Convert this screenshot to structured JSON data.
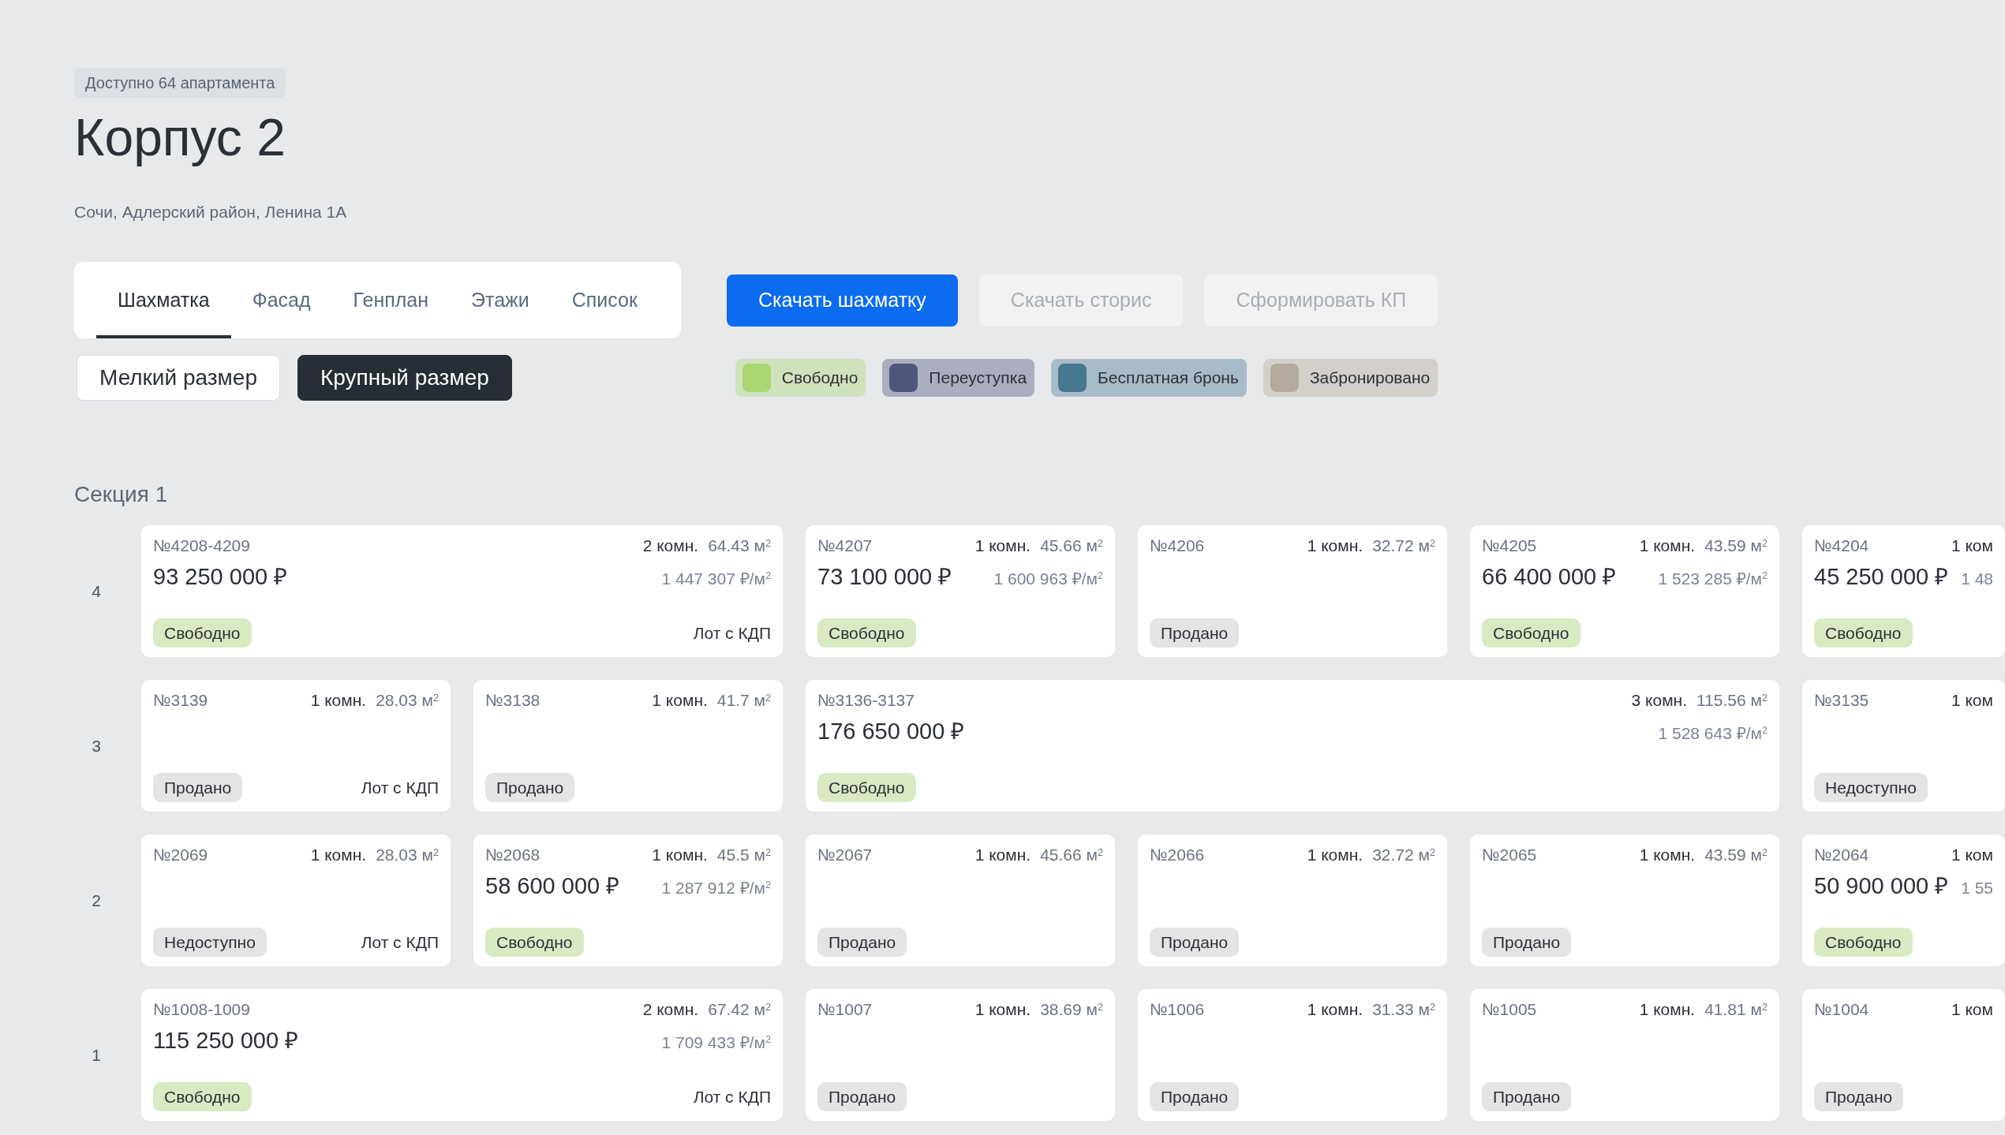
{
  "availability_badge": "Доступно 64 апартамента",
  "title": "Корпус 2",
  "address": "Сочи, Адлерский район, Ленина 1А",
  "tabs": [
    {
      "label": "Шахматка",
      "selected": true
    },
    {
      "label": "Фасад",
      "selected": false
    },
    {
      "label": "Генплан",
      "selected": false
    },
    {
      "label": "Этажи",
      "selected": false
    },
    {
      "label": "Список",
      "selected": false
    }
  ],
  "actions": [
    {
      "label": "Скачать шахматку",
      "disabled": false
    },
    {
      "label": "Скачать сторис",
      "disabled": true
    },
    {
      "label": "Сформировать КП",
      "disabled": true
    }
  ],
  "size_toggle": [
    {
      "label": "Мелкий размер",
      "selected": false
    },
    {
      "label": "Крупный размер",
      "selected": true
    }
  ],
  "legend": [
    {
      "label": "Свободно",
      "color": "#a9d673"
    },
    {
      "label": "Переуступка",
      "color": "#50557a"
    },
    {
      "label": "Бесплатная бронь",
      "color": "#46788f"
    },
    {
      "label": "Забронировано",
      "color": "#b4aa9c"
    }
  ],
  "section_title": "Секция 1",
  "floors": [
    {
      "label": "4",
      "units": [
        {
          "kind": "double",
          "number": "№4208-4209",
          "rooms": "2 комн.",
          "area": "64.43 м$^{2}$",
          "price": "93 250 000 ₽",
          "price_per_m2": "1 447 307 ₽/м$^{2}$",
          "status": {
            "kind": "free",
            "label": "Свободно"
          },
          "note": "Лот с КДП"
        },
        {
          "kind": "single",
          "number": "№4207",
          "rooms": "1 комн.",
          "area": "45.66 м$^{2}$",
          "price": "73 100 000 ₽",
          "price_per_m2": "1 600 963 ₽/м$^{2}$",
          "status": {
            "kind": "free",
            "label": "Свободно"
          }
        },
        {
          "kind": "single",
          "number": "№4206",
          "rooms": "1 комн.",
          "area": "32.72 м$^{2}$",
          "status": {
            "kind": "sold",
            "label": "Продано"
          }
        },
        {
          "kind": "single",
          "number": "№4205",
          "rooms": "1 комн.",
          "area": "43.59 м$^{2}$",
          "price": "66 400 000 ₽",
          "price_per_m2": "1 523 285 ₽/м$^{2}$",
          "status": {
            "kind": "free",
            "label": "Свободно"
          }
        },
        {
          "kind": "single",
          "number": "№4204",
          "rooms": "1 ком",
          "price": "45 250 000 ₽",
          "price_per_m2": "1 48",
          "status": {
            "kind": "free",
            "label": "Свободно"
          }
        }
      ]
    },
    {
      "label": "3",
      "units": [
        {
          "kind": "single",
          "number": "№3139",
          "rooms": "1 комн.",
          "area": "28.03 м$^{2}$",
          "status": {
            "kind": "sold",
            "label": "Продано"
          },
          "note": "Лот с КДП"
        },
        {
          "kind": "single",
          "number": "№3138",
          "rooms": "1 комн.",
          "area": "41.7 м$^{2}$",
          "status": {
            "kind": "sold",
            "label": "Продано"
          }
        },
        {
          "kind": "triple",
          "number": "№3136-3137",
          "rooms": "3 комн.",
          "area": "115.56 м$^{2}$",
          "price": "176 650 000 ₽",
          "price_per_m2": "1 528 643 ₽/м$^{2}$",
          "status": {
            "kind": "free",
            "label": "Свободно"
          }
        },
        {
          "kind": "single",
          "number": "№3135",
          "rooms": "1 ком",
          "status": {
            "kind": "unavailable",
            "label": "Недоступно"
          }
        }
      ]
    },
    {
      "label": "2",
      "units": [
        {
          "kind": "single",
          "number": "№2069",
          "rooms": "1 комн.",
          "area": "28.03 м$^{2}$",
          "status": {
            "kind": "unavailable",
            "label": "Недоступно"
          },
          "note": "Лот с КДП"
        },
        {
          "kind": "single",
          "number": "№2068",
          "rooms": "1 комн.",
          "area": "45.5 м$^{2}$",
          "price": "58 600 000 ₽",
          "price_per_m2": "1 287 912 ₽/м$^{2}$",
          "status": {
            "kind": "free",
            "label": "Свободно"
          }
        },
        {
          "kind": "single",
          "number": "№2067",
          "rooms": "1 комн.",
          "area": "45.66 м$^{2}$",
          "status": {
            "kind": "sold",
            "label": "Продано"
          }
        },
        {
          "kind": "single",
          "number": "№2066",
          "rooms": "1 комн.",
          "area": "32.72 м$^{2}$",
          "status": {
            "kind": "sold",
            "label": "Продано"
          }
        },
        {
          "kind": "single",
          "number": "№2065",
          "rooms": "1 комн.",
          "area": "43.59 м$^{2}$",
          "status": {
            "kind": "sold",
            "label": "Продано"
          }
        },
        {
          "kind": "single",
          "number": "№2064",
          "rooms": "1 ком",
          "price": "50 900 000 ₽",
          "price_per_m2": "1 55",
          "status": {
            "kind": "free",
            "label": "Свободно"
          }
        }
      ]
    },
    {
      "label": "1",
      "units": [
        {
          "kind": "double",
          "number": "№1008-1009",
          "rooms": "2 комн.",
          "area": "67.42 м$^{2}$",
          "price": "115 250 000 ₽",
          "price_per_m2": "1 709 433 ₽/м$^{2}$",
          "status": {
            "kind": "free",
            "label": "Свободно"
          },
          "note": "Лот с КДП"
        },
        {
          "kind": "single",
          "number": "№1007",
          "rooms": "1 комн.",
          "area": "38.69 м$^{2}$",
          "status": {
            "kind": "sold",
            "label": "Продано"
          }
        },
        {
          "kind": "single",
          "number": "№1006",
          "rooms": "1 комн.",
          "area": "31.33 м$^{2}$",
          "status": {
            "kind": "sold",
            "label": "Продано"
          }
        },
        {
          "kind": "single",
          "number": "№1005",
          "rooms": "1 комн.",
          "area": "41.81 м$^{2}$",
          "status": {
            "kind": "sold",
            "label": "Продано"
          }
        },
        {
          "kind": "single",
          "number": "№1004",
          "rooms": "1 ком",
          "status": {
            "kind": "sold",
            "label": "Продано"
          }
        }
      ]
    }
  ]
}
